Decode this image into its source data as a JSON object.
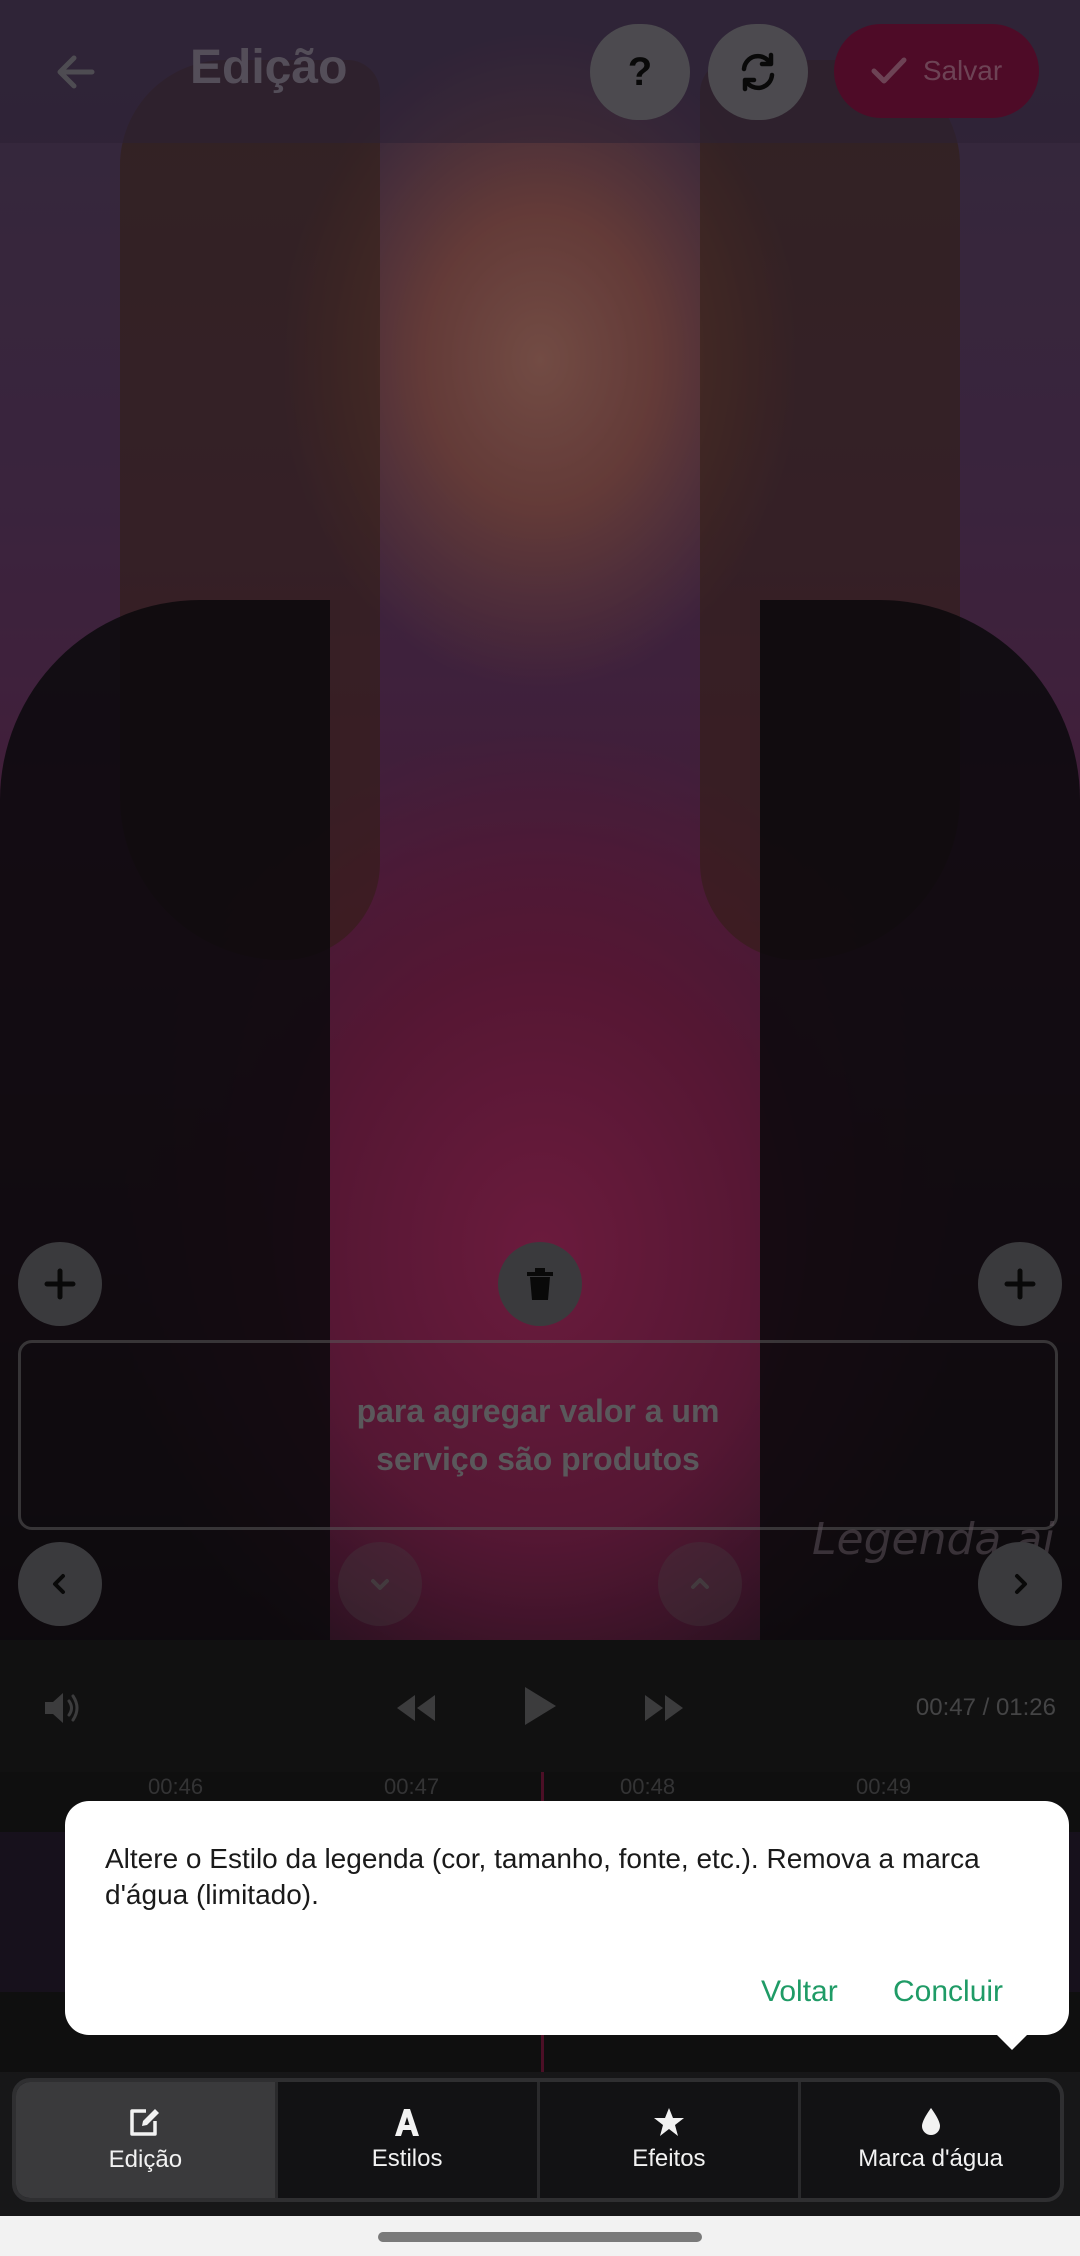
{
  "header": {
    "title": "Edição",
    "save_label": "Salvar",
    "help_label": "?"
  },
  "subtitle": {
    "text": "para agregar valor a um\nserviço são produtos",
    "watermark": "Legenda.ai"
  },
  "player": {
    "time": "00:47 / 01:26"
  },
  "timeline": {
    "ticks": [
      "00:46",
      "00:47",
      "00:48",
      "00:49"
    ]
  },
  "tooltip": {
    "text": "Altere o Estilo da legenda (cor, tamanho, fonte, etc.). Remova a marca d'água (limitado).",
    "back_label": "Voltar",
    "done_label": "Concluir"
  },
  "nav": {
    "items": [
      {
        "label": "Edição",
        "icon": "edit-icon",
        "active": true
      },
      {
        "label": "Estilos",
        "icon": "font-a-icon",
        "active": false
      },
      {
        "label": "Efeitos",
        "icon": "star-icon",
        "active": false
      },
      {
        "label": "Marca d'água",
        "icon": "droplet-icon",
        "active": false
      }
    ]
  },
  "colors": {
    "accent": "#1f9b66",
    "save_button": "#8e1547"
  }
}
